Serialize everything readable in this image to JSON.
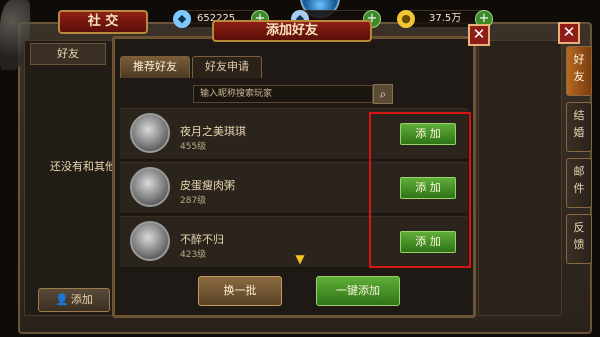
{
  "top_bar": {
    "resources": [
      {
        "icon": "diamond-icon",
        "value": "652225"
      },
      {
        "icon": "diamond-bound-icon",
        "value": ""
      },
      {
        "icon": "gold-coin-icon",
        "value": "37.5万"
      }
    ]
  },
  "social": {
    "title": "社 交",
    "friends_tab": "好友",
    "empty_text": "还没有和其他",
    "add_button": "添加"
  },
  "side_tabs": [
    {
      "label": "好\n友",
      "active": true
    },
    {
      "label": "结\n婚",
      "active": false
    },
    {
      "label": "邮\n件",
      "active": false
    },
    {
      "label": "反\n馈",
      "active": false
    }
  ],
  "dialog": {
    "title": "添加好友",
    "tabs": [
      {
        "label": "推荐好友",
        "active": true
      },
      {
        "label": "好友申请",
        "active": false
      }
    ],
    "search": {
      "placeholder": "输入昵称搜索玩家"
    },
    "players": [
      {
        "name": "夜月之美琪琪",
        "level": "455级",
        "add_label": "添 加"
      },
      {
        "name": "皮蛋瘦肉粥",
        "level": "287级",
        "add_label": "添 加"
      },
      {
        "name": "不醉不归",
        "level": "423级",
        "add_label": "添 加"
      }
    ],
    "refresh_button": "换一批",
    "one_click_button": "一键添加"
  }
}
